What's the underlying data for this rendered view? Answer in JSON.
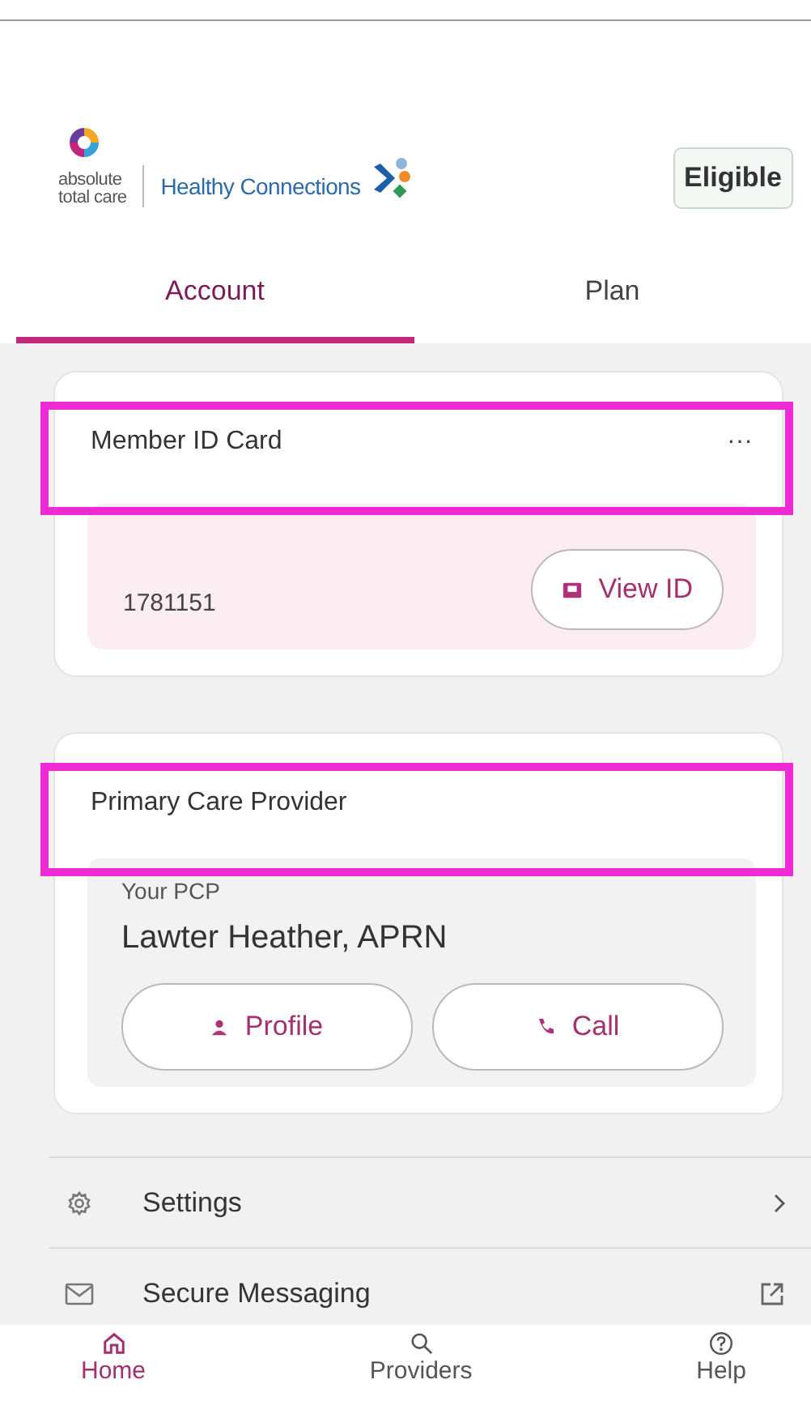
{
  "header": {
    "brand_line_1": "absolute",
    "brand_line_2": "total care",
    "program": "Healthy Connections",
    "status_badge": "Eligible"
  },
  "tabs": [
    {
      "label": "Account",
      "selected": true
    },
    {
      "label": "Plan",
      "selected": false
    }
  ],
  "member_card": {
    "title": "Member ID Card",
    "highlighted": true,
    "more": "···",
    "member_id": "1781151",
    "button": "View ID"
  },
  "pcp_card": {
    "title": "Primary Care Provider",
    "highlighted": true,
    "caption": "Your PCP",
    "name": "Lawter Heather, APRN",
    "buttons": [
      {
        "kind": "profile",
        "label": "Profile"
      },
      {
        "kind": "call",
        "label": "Call"
      }
    ]
  },
  "menu": [
    {
      "kind": "settings",
      "label": "Settings",
      "external": false
    },
    {
      "kind": "messaging",
      "label": "Secure Messaging",
      "external": true
    }
  ],
  "bottom_nav": [
    {
      "kind": "home",
      "label": "Home",
      "selected": true
    },
    {
      "kind": "providers",
      "label": "Providers",
      "selected": false
    },
    {
      "kind": "help",
      "label": "Help",
      "selected": false
    }
  ]
}
